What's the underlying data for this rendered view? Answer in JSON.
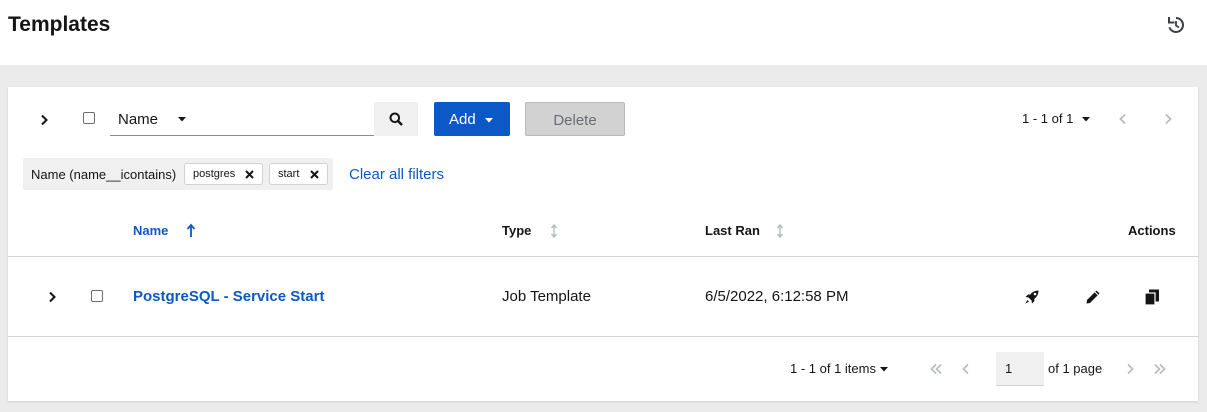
{
  "header": {
    "title": "Templates",
    "history_icon": "history-icon"
  },
  "toolbar": {
    "filter_field": "Name",
    "search_placeholder": "",
    "search_value": "",
    "add_label": "Add",
    "delete_label": "Delete",
    "pagination_label": "1 - 1 of 1"
  },
  "filters": {
    "category_label": "Name (name__icontains)",
    "chips": [
      "postgres",
      "start"
    ],
    "clear_all_label": "Clear all filters"
  },
  "table": {
    "columns": {
      "name": "Name",
      "type": "Type",
      "last_ran": "Last Ran",
      "actions": "Actions"
    },
    "rows": [
      {
        "name": "PostgreSQL - Service Start",
        "type": "Job Template",
        "last_ran": "6/5/2022, 6:12:58 PM",
        "actions": [
          "rocket-icon",
          "pencil-icon",
          "copy-icon"
        ]
      }
    ]
  },
  "footer": {
    "items_label": "1 - 1 of 1 items",
    "page_value": "1",
    "of_pages_label": "of 1 page"
  },
  "colors": {
    "link": "#0b58c6",
    "primary_button": "#0b58c6",
    "disabled_button": "#d2d2d2",
    "page_background": "#ebebeb"
  }
}
